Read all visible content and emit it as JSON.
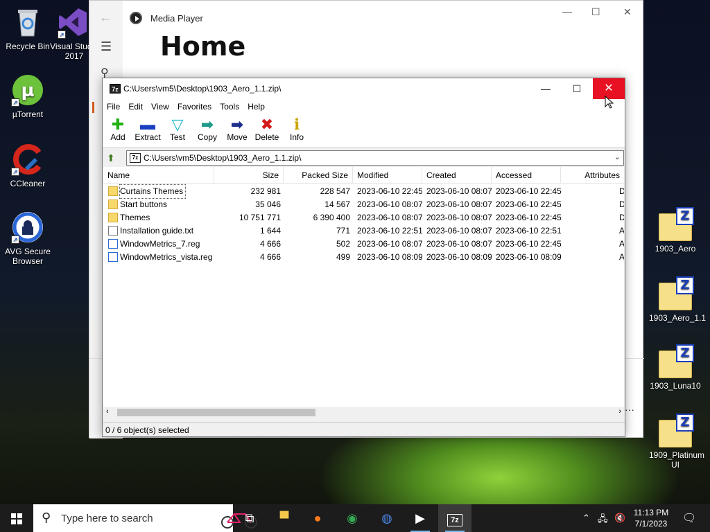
{
  "desktop_left": [
    {
      "label": "Recycle Bin"
    },
    {
      "label": "Visual Studio 2017"
    },
    {
      "label": "µTorrent"
    },
    {
      "label": "CCleaner"
    },
    {
      "label": "AVG Secure Browser"
    }
  ],
  "desktop_right": [
    {
      "label": "1903_Aero"
    },
    {
      "label": "1903_Aero_1.1"
    },
    {
      "label": "1903_Luna10"
    },
    {
      "label": "1909_Platinum UI"
    }
  ],
  "media_player": {
    "app_title": "Media Player",
    "page_title": "Home"
  },
  "zip_window": {
    "title": "C:\\Users\\vm5\\Desktop\\1903_Aero_1.1.zip\\",
    "icon_text": "7z",
    "menu": [
      "File",
      "Edit",
      "View",
      "Favorites",
      "Tools",
      "Help"
    ],
    "toolbar": [
      {
        "label": "Add",
        "icon": "plus-icon",
        "color": "#22b014"
      },
      {
        "label": "Extract",
        "icon": "minus-icon",
        "color": "#1a3fc0"
      },
      {
        "label": "Test",
        "icon": "check-icon",
        "color": "#19b7c9"
      },
      {
        "label": "Copy",
        "icon": "copy-arrow-icon",
        "color": "#1e9a8a"
      },
      {
        "label": "Move",
        "icon": "move-arrow-icon",
        "color": "#1c2e8c"
      },
      {
        "label": "Delete",
        "icon": "x-icon",
        "color": "#d21a1a"
      },
      {
        "label": "Info",
        "icon": "info-icon",
        "color": "#c9a400"
      }
    ],
    "address": "C:\\Users\\vm5\\Desktop\\1903_Aero_1.1.zip\\",
    "columns": [
      "Name",
      "Size",
      "Packed Size",
      "Modified",
      "Created",
      "Accessed",
      "Attributes"
    ],
    "rows": [
      {
        "name": "Curtains Themes",
        "type": "folder",
        "size": "232 981",
        "packed": "228 547",
        "modified": "2023-06-10 22:45",
        "created": "2023-06-10 08:07",
        "accessed": "2023-06-10 22:45",
        "attr": "D"
      },
      {
        "name": "Start buttons",
        "type": "folder",
        "size": "35 046",
        "packed": "14 567",
        "modified": "2023-06-10 08:07",
        "created": "2023-06-10 08:07",
        "accessed": "2023-06-10 22:45",
        "attr": "D"
      },
      {
        "name": "Themes",
        "type": "folder",
        "size": "10 751 771",
        "packed": "6 390 400",
        "modified": "2023-06-10 08:07",
        "created": "2023-06-10 08:07",
        "accessed": "2023-06-10 22:45",
        "attr": "D"
      },
      {
        "name": "Installation guide.txt",
        "type": "txt",
        "size": "1 644",
        "packed": "771",
        "modified": "2023-06-10 22:51",
        "created": "2023-06-10 08:07",
        "accessed": "2023-06-10 22:51",
        "attr": "A"
      },
      {
        "name": "WindowMetrics_7.reg",
        "type": "reg",
        "size": "4 666",
        "packed": "502",
        "modified": "2023-06-10 08:07",
        "created": "2023-06-10 08:07",
        "accessed": "2023-06-10 22:45",
        "attr": "A"
      },
      {
        "name": "WindowMetrics_vista.reg",
        "type": "reg",
        "size": "4 666",
        "packed": "499",
        "modified": "2023-06-10 08:09",
        "created": "2023-06-10 08:09",
        "accessed": "2023-06-10 08:09",
        "attr": "A"
      }
    ],
    "status": "0 / 6 object(s) selected"
  },
  "taskbar": {
    "search_placeholder": "Type here to search",
    "time": "11:13 PM",
    "date": "7/1/2023",
    "icon_7z": "7z"
  }
}
